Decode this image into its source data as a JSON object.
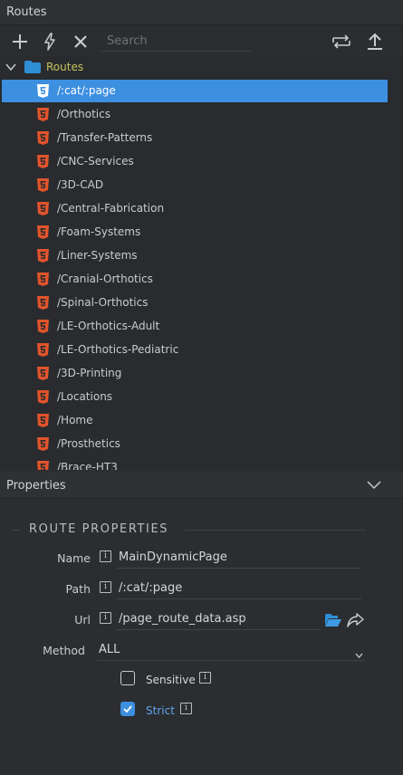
{
  "routes_panel": {
    "title": "Routes"
  },
  "toolbar": {
    "search_placeholder": "Search",
    "icons": [
      "add-icon",
      "lightning-icon",
      "close-icon",
      "swap-icon",
      "upload-icon"
    ]
  },
  "tree": {
    "root_label": "Routes",
    "items": [
      {
        "label": "/:cat/:page",
        "selected": true
      },
      {
        "label": "/Orthotics",
        "selected": false
      },
      {
        "label": "/Transfer-Patterns",
        "selected": false
      },
      {
        "label": "/CNC-Services",
        "selected": false
      },
      {
        "label": "/3D-CAD",
        "selected": false
      },
      {
        "label": "/Central-Fabrication",
        "selected": false
      },
      {
        "label": "/Foam-Systems",
        "selected": false
      },
      {
        "label": "/Liner-Systems",
        "selected": false
      },
      {
        "label": "/Cranial-Orthotics",
        "selected": false
      },
      {
        "label": "/Spinal-Orthotics",
        "selected": false
      },
      {
        "label": "/LE-Orthotics-Adult",
        "selected": false
      },
      {
        "label": "/LE-Orthotics-Pediatric",
        "selected": false
      },
      {
        "label": "/3D-Printing",
        "selected": false
      },
      {
        "label": "/Locations",
        "selected": false
      },
      {
        "label": "/Home",
        "selected": false
      },
      {
        "label": "/Prosthetics",
        "selected": false
      },
      {
        "label": "/Brace-HT3",
        "selected": false
      }
    ]
  },
  "properties_panel": {
    "title": "Properties",
    "section_title": "ROUTE PROPERTIES",
    "name_label": "Name",
    "name_value": "MainDynamicPage",
    "path_label": "Path",
    "path_value": "/:cat/:page",
    "url_label": "Url",
    "url_value": "/page_route_data.asp",
    "method_label": "Method",
    "method_value": "ALL",
    "sensitive_label": "Sensitive",
    "sensitive_checked": false,
    "strict_label": "Strict",
    "strict_checked": true
  },
  "colors": {
    "accent": "#3d8fe0",
    "html5_icon": "#e0542c",
    "folder": "#2e8fd4",
    "root_label": "#c6c261"
  }
}
